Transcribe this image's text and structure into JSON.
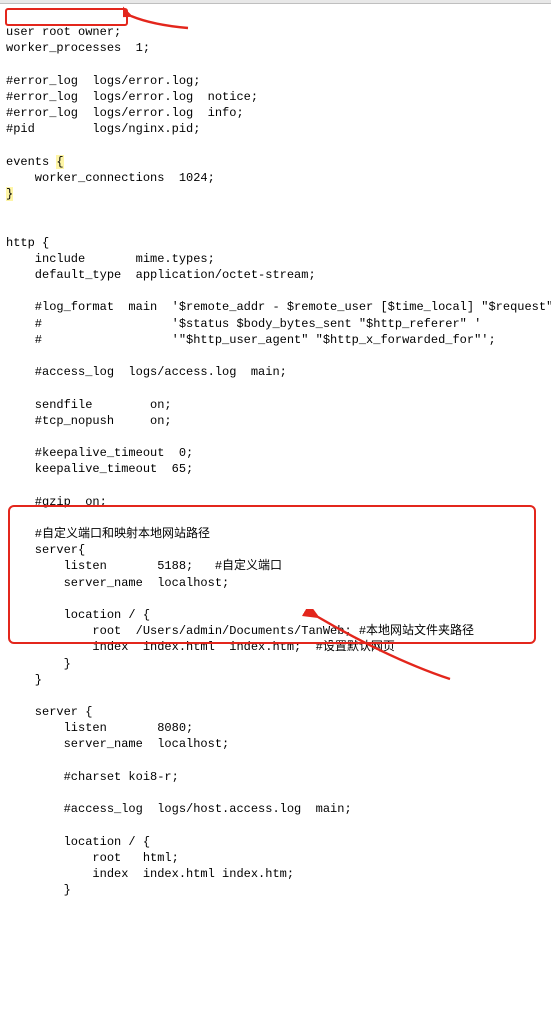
{
  "code": {
    "l01": "user root owner;",
    "l02": "worker_processes  1;",
    "l03": "",
    "l04": "#error_log  logs/error.log;",
    "l05": "#error_log  logs/error.log  notice;",
    "l06": "#error_log  logs/error.log  info;",
    "l07": "#pid        logs/nginx.pid;",
    "l08": "",
    "l09a": "events ",
    "l09b": "{",
    "l10": "    worker_connections  1024;",
    "l11a": "}",
    "l12": "",
    "l13": "",
    "l14": "http {",
    "l15": "    include       mime.types;",
    "l16": "    default_type  application/octet-stream;",
    "l17": "",
    "l18": "    #log_format  main  '$remote_addr - $remote_user [$time_local] \"$request\" '",
    "l19": "    #                  '$status $body_bytes_sent \"$http_referer\" '",
    "l20": "    #                  '\"$http_user_agent\" \"$http_x_forwarded_for\"';",
    "l21": "",
    "l22": "    #access_log  logs/access.log  main;",
    "l23": "",
    "l24": "    sendfile        on;",
    "l25": "    #tcp_nopush     on;",
    "l26": "",
    "l27": "    #keepalive_timeout  0;",
    "l28": "    keepalive_timeout  65;",
    "l29": "",
    "l30": "    #gzip  on;",
    "l31": "",
    "l32": "    #自定义端口和映射本地网站路径",
    "l33": "    server{",
    "l34": "        listen       5188;   #自定义端口",
    "l35": "        server_name  localhost;",
    "l36": "",
    "l37": "        location / {",
    "l38": "            root  /Users/admin/Documents/TanWeb; #本地网站文件夹路径",
    "l39": "            index  index.html  index.htm;  #设置默认网页",
    "l40": "        }",
    "l41": "    }",
    "l42": "",
    "l43": "    server {",
    "l44": "        listen       8080;",
    "l45": "        server_name  localhost;",
    "l46": "",
    "l47": "        #charset koi8-r;",
    "l48": "",
    "l49": "        #access_log  logs/host.access.log  main;",
    "l50": "",
    "l51": "        location / {",
    "l52": "            root   html;",
    "l53": "            index  index.html index.htm;",
    "l54": "        }"
  },
  "annotations": {
    "box1_target": "user root owner;",
    "box2_target": "custom server block"
  }
}
